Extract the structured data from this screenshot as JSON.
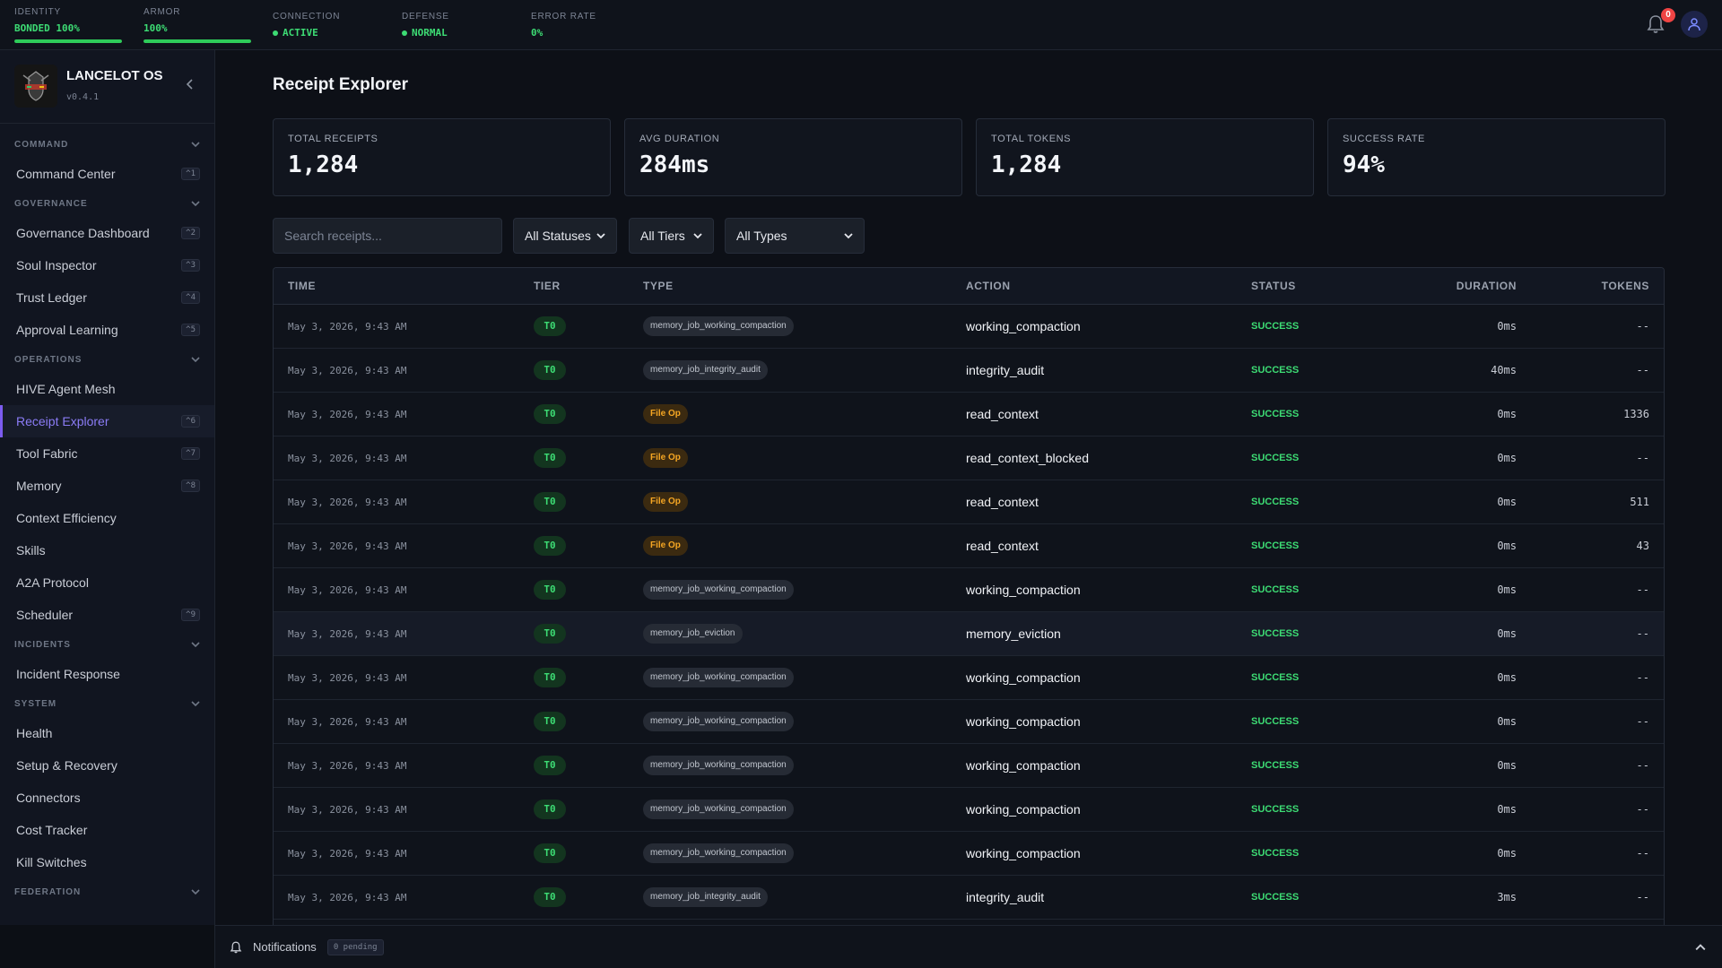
{
  "topbar": {
    "identity": {
      "label": "IDENTITY",
      "value": "BONDED 100%",
      "level": 1.0
    },
    "armor": {
      "label": "ARMOR",
      "value": "100%",
      "level": 1.0
    },
    "connection": {
      "label": "CONNECTION",
      "value": "ACTIVE"
    },
    "defense": {
      "label": "DEFENSE",
      "value": "NORMAL"
    },
    "error_rate": {
      "label": "ERROR RATE",
      "value": "0%"
    },
    "notification_count": "0"
  },
  "brand": {
    "name": "LANCELOT OS",
    "version": "v0.4.1"
  },
  "sidebar": {
    "sections": [
      {
        "label": "COMMAND",
        "items": [
          {
            "label": "Command Center",
            "kbd": "^1"
          }
        ]
      },
      {
        "label": "GOVERNANCE",
        "items": [
          {
            "label": "Governance Dashboard",
            "kbd": "^2"
          },
          {
            "label": "Soul Inspector",
            "kbd": "^3"
          },
          {
            "label": "Trust Ledger",
            "kbd": "^4"
          },
          {
            "label": "Approval Learning",
            "kbd": "^5"
          }
        ]
      },
      {
        "label": "OPERATIONS",
        "items": [
          {
            "label": "HIVE Agent Mesh",
            "kbd": ""
          },
          {
            "label": "Receipt Explorer",
            "kbd": "^6",
            "active": true
          },
          {
            "label": "Tool Fabric",
            "kbd": "^7"
          },
          {
            "label": "Memory",
            "kbd": "^8"
          },
          {
            "label": "Context Efficiency",
            "kbd": ""
          },
          {
            "label": "Skills",
            "kbd": ""
          },
          {
            "label": "A2A Protocol",
            "kbd": ""
          },
          {
            "label": "Scheduler",
            "kbd": "^9"
          }
        ]
      },
      {
        "label": "INCIDENTS",
        "items": [
          {
            "label": "Incident Response",
            "kbd": ""
          }
        ]
      },
      {
        "label": "SYSTEM",
        "items": [
          {
            "label": "Health",
            "kbd": ""
          },
          {
            "label": "Setup & Recovery",
            "kbd": ""
          },
          {
            "label": "Connectors",
            "kbd": ""
          },
          {
            "label": "Cost Tracker",
            "kbd": ""
          },
          {
            "label": "Kill Switches",
            "kbd": ""
          }
        ]
      },
      {
        "label": "FEDERATION",
        "items": []
      }
    ]
  },
  "page": {
    "title": "Receipt Explorer",
    "stats": [
      {
        "label": "TOTAL RECEIPTS",
        "value": "1,284"
      },
      {
        "label": "AVG DURATION",
        "value": "284ms"
      },
      {
        "label": "TOTAL TOKENS",
        "value": "1,284"
      },
      {
        "label": "SUCCESS RATE",
        "value": "94%"
      }
    ],
    "search_placeholder": "Search receipts...",
    "filters": {
      "status": "All Statuses",
      "tier": "All Tiers",
      "type": "All Types"
    }
  },
  "table": {
    "columns": [
      "TIME",
      "TIER",
      "TYPE",
      "ACTION",
      "STATUS",
      "DURATION",
      "TOKENS"
    ],
    "rows": [
      {
        "time": "May 3, 2026, 9:43 AM",
        "tier": "T0",
        "type": "memory_job_working_compaction",
        "action": "working_compaction",
        "status": "SUCCESS",
        "duration": "0ms",
        "tokens": "--"
      },
      {
        "time": "May 3, 2026, 9:43 AM",
        "tier": "T0",
        "type": "memory_job_integrity_audit",
        "action": "integrity_audit",
        "status": "SUCCESS",
        "duration": "40ms",
        "tokens": "--"
      },
      {
        "time": "May 3, 2026, 9:43 AM",
        "tier": "T0",
        "type": "File Op",
        "action": "read_context",
        "status": "SUCCESS",
        "duration": "0ms",
        "tokens": "1336"
      },
      {
        "time": "May 3, 2026, 9:43 AM",
        "tier": "T0",
        "type": "File Op",
        "action": "read_context_blocked",
        "status": "SUCCESS",
        "duration": "0ms",
        "tokens": "--"
      },
      {
        "time": "May 3, 2026, 9:43 AM",
        "tier": "T0",
        "type": "File Op",
        "action": "read_context",
        "status": "SUCCESS",
        "duration": "0ms",
        "tokens": "511"
      },
      {
        "time": "May 3, 2026, 9:43 AM",
        "tier": "T0",
        "type": "File Op",
        "action": "read_context",
        "status": "SUCCESS",
        "duration": "0ms",
        "tokens": "43"
      },
      {
        "time": "May 3, 2026, 9:43 AM",
        "tier": "T0",
        "type": "memory_job_working_compaction",
        "action": "working_compaction",
        "status": "SUCCESS",
        "duration": "0ms",
        "tokens": "--"
      },
      {
        "time": "May 3, 2026, 9:43 AM",
        "tier": "T0",
        "type": "memory_job_eviction",
        "action": "memory_eviction",
        "status": "SUCCESS",
        "duration": "0ms",
        "tokens": "--"
      },
      {
        "time": "May 3, 2026, 9:43 AM",
        "tier": "T0",
        "type": "memory_job_working_compaction",
        "action": "working_compaction",
        "status": "SUCCESS",
        "duration": "0ms",
        "tokens": "--"
      },
      {
        "time": "May 3, 2026, 9:43 AM",
        "tier": "T0",
        "type": "memory_job_working_compaction",
        "action": "working_compaction",
        "status": "SUCCESS",
        "duration": "0ms",
        "tokens": "--"
      },
      {
        "time": "May 3, 2026, 9:43 AM",
        "tier": "T0",
        "type": "memory_job_working_compaction",
        "action": "working_compaction",
        "status": "SUCCESS",
        "duration": "0ms",
        "tokens": "--"
      },
      {
        "time": "May 3, 2026, 9:43 AM",
        "tier": "T0",
        "type": "memory_job_working_compaction",
        "action": "working_compaction",
        "status": "SUCCESS",
        "duration": "0ms",
        "tokens": "--"
      },
      {
        "time": "May 3, 2026, 9:43 AM",
        "tier": "T0",
        "type": "memory_job_working_compaction",
        "action": "working_compaction",
        "status": "SUCCESS",
        "duration": "0ms",
        "tokens": "--"
      },
      {
        "time": "May 3, 2026, 9:43 AM",
        "tier": "T0",
        "type": "memory_job_integrity_audit",
        "action": "integrity_audit",
        "status": "SUCCESS",
        "duration": "3ms",
        "tokens": "--"
      }
    ]
  },
  "bottombar": {
    "label": "Notifications",
    "pending": "0 pending"
  },
  "colors": {
    "accent": "#7c5cf0",
    "success": "#3ddc74",
    "file_op": "#f5a623",
    "danger": "#ef4444"
  },
  "icons": [
    "bell-icon",
    "user-icon",
    "chevron-left-icon",
    "chevron-down-icon",
    "chevron-up-icon"
  ]
}
